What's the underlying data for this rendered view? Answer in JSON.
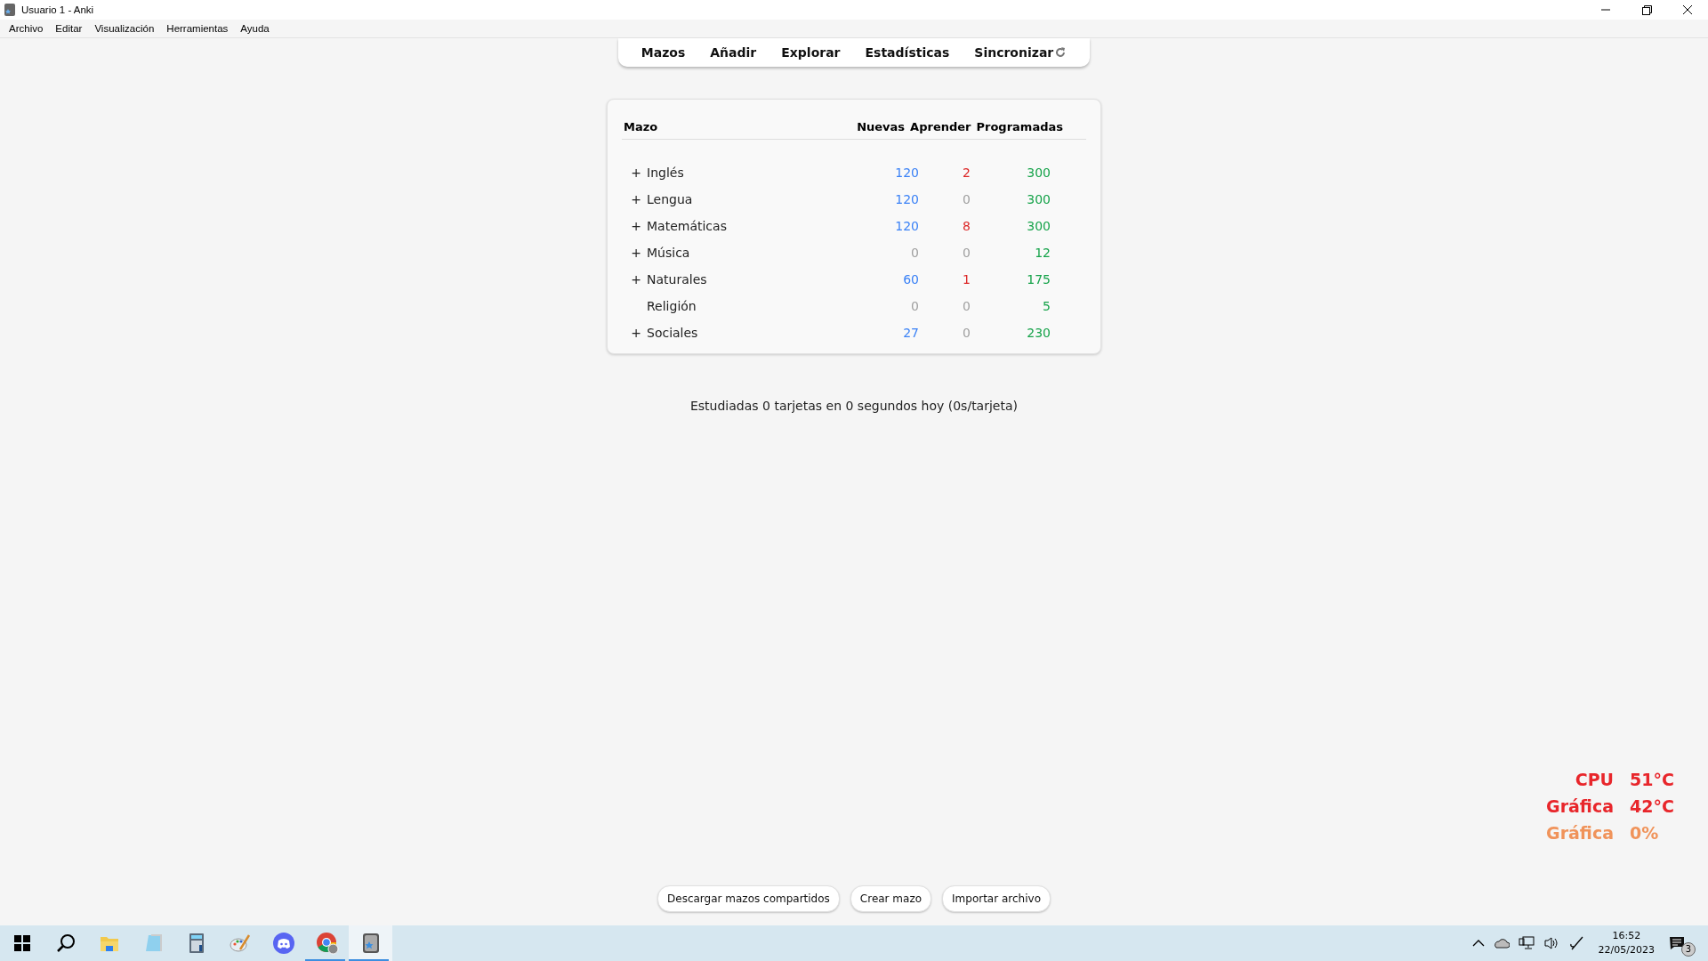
{
  "window": {
    "title": "Usuario 1 - Anki"
  },
  "menu": [
    "Archivo",
    "Editar",
    "Visualización",
    "Herramientas",
    "Ayuda"
  ],
  "toolbar": [
    "Mazos",
    "Añadir",
    "Explorar",
    "Estadísticas",
    "Sincronizar"
  ],
  "deck_table": {
    "columns": [
      "Mazo",
      "Nuevas",
      "Aprender",
      "Programadas"
    ],
    "rows": [
      {
        "toggle": "+",
        "name": "Inglés",
        "new": {
          "text": "120",
          "muted": false
        },
        "learn": {
          "text": "2",
          "muted": false
        },
        "due": {
          "text": "300",
          "muted": false
        }
      },
      {
        "toggle": "+",
        "name": "Lengua",
        "new": {
          "text": "120",
          "muted": false
        },
        "learn": {
          "text": "0",
          "muted": true
        },
        "due": {
          "text": "300",
          "muted": false
        }
      },
      {
        "toggle": "+",
        "name": "Matemáticas",
        "new": {
          "text": "120",
          "muted": false
        },
        "learn": {
          "text": "8",
          "muted": false
        },
        "due": {
          "text": "300",
          "muted": false
        }
      },
      {
        "toggle": "+",
        "name": "Música",
        "new": {
          "text": "0",
          "muted": true
        },
        "learn": {
          "text": "0",
          "muted": true
        },
        "due": {
          "text": "12",
          "muted": false
        }
      },
      {
        "toggle": "+",
        "name": "Naturales",
        "new": {
          "text": "60",
          "muted": false
        },
        "learn": {
          "text": "1",
          "muted": false
        },
        "due": {
          "text": "175",
          "muted": false
        }
      },
      {
        "name": "Religión",
        "new": {
          "text": "0",
          "muted": true
        },
        "learn": {
          "text": "0",
          "muted": true
        },
        "due": {
          "text": "5",
          "muted": false
        }
      },
      {
        "toggle": "+",
        "name": "Sociales",
        "new": {
          "text": "27",
          "muted": false
        },
        "learn": {
          "text": "0",
          "muted": true
        },
        "due": {
          "text": "230",
          "muted": false
        }
      }
    ]
  },
  "study_summary": "Estudiadas 0 tarjetas en 0 segundos hoy (0s/tarjeta)",
  "bottom_buttons": [
    "Descargar mazos compartidos",
    "Crear mazo",
    "Importar archivo"
  ],
  "temperature_overlay": [
    {
      "label": "CPU",
      "value": "51°C",
      "color": "#e8262b"
    },
    {
      "label": "Gráfica",
      "value": "42°C",
      "color": "#e8262b"
    },
    {
      "label": "Gráfica",
      "value": "0%",
      "color": "#f0935a"
    }
  ],
  "taskbar": {
    "apps": [
      {
        "kind": "start",
        "running": false,
        "selected": false
      },
      {
        "kind": "search",
        "running": false,
        "selected": false
      },
      {
        "kind": "folder",
        "running": false,
        "selected": false
      },
      {
        "kind": "notepad",
        "running": false,
        "selected": false
      },
      {
        "kind": "calculator",
        "running": false,
        "selected": false
      },
      {
        "kind": "paint",
        "running": false,
        "selected": false
      },
      {
        "kind": "chat",
        "running": false,
        "selected": false
      },
      {
        "kind": "browser",
        "running": true,
        "selected": false
      },
      {
        "kind": "anki",
        "running": true,
        "selected": true
      }
    ],
    "time": "16:52",
    "date": "22/05/2023",
    "notifications": "3"
  }
}
